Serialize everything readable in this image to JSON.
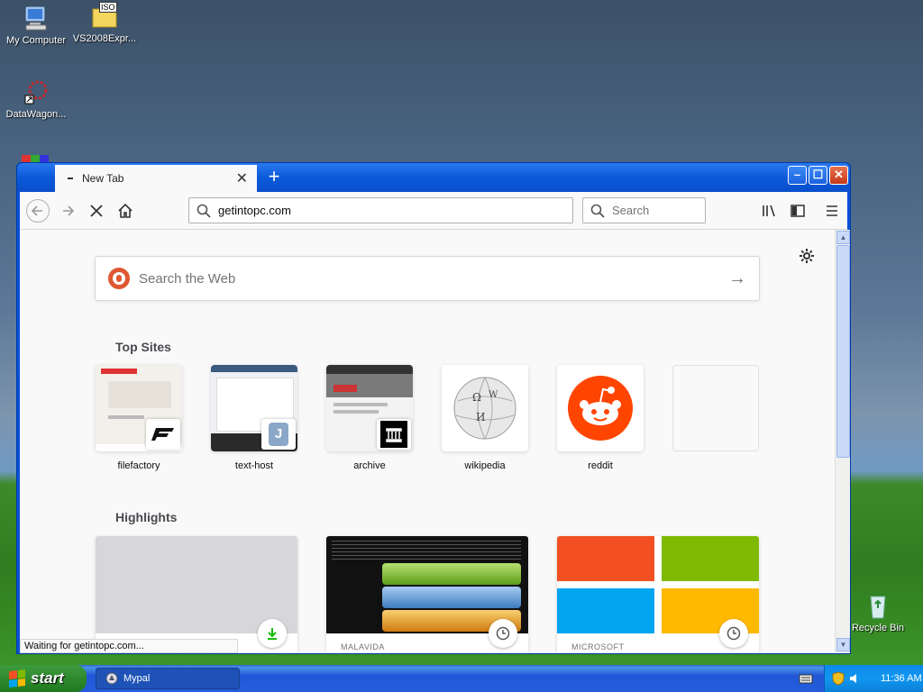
{
  "desktop": {
    "icons": [
      {
        "label": "My Computer"
      },
      {
        "label": "VS2008Expr..."
      },
      {
        "label": "DataWagon..."
      },
      {
        "label": "Recycle Bin"
      }
    ],
    "iso_label": "ISO"
  },
  "browser": {
    "tab": {
      "title": "New Tab"
    },
    "url": "getintopc.com",
    "search_placeholder": "Search",
    "websearch_placeholder": "Search the Web",
    "top_sites_title": "Top Sites",
    "top_sites": [
      {
        "name": "filefactory"
      },
      {
        "name": "text-host"
      },
      {
        "name": "archive"
      },
      {
        "name": "wikipedia"
      },
      {
        "name": "reddit"
      },
      {
        "name": ""
      }
    ],
    "highlights_title": "Highlights",
    "highlights": [
      {
        "source": ""
      },
      {
        "source": "MALAVIDA"
      },
      {
        "source": "MICROSOFT"
      }
    ],
    "status": "Waiting for getintopc.com..."
  },
  "taskbar": {
    "start_label": "start",
    "task_label": "Mypal",
    "clock": "11:36 AM"
  },
  "colors": {
    "reddit": "#ff4500",
    "ms_red": "#f25022",
    "ms_green": "#7fba00",
    "ms_blue": "#00a4ef",
    "ms_yellow": "#ffb900"
  }
}
